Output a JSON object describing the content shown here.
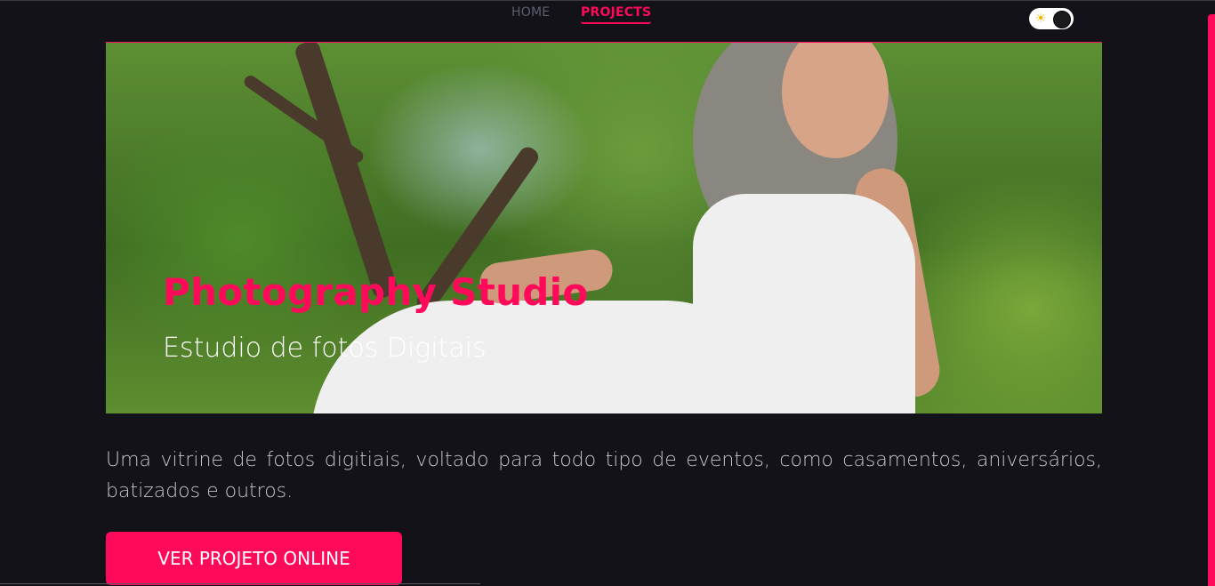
{
  "nav": {
    "home_label": "HOME",
    "projects_label": "PROJECTS"
  },
  "theme_toggle": {
    "state": "dark",
    "sun_icon": "sun-icon"
  },
  "hero": {
    "title": "Photography Studio",
    "subtitle": "Estudio de fotos Digitais"
  },
  "description": "Uma vitrine de fotos digitiais, voltado para todo tipo de eventos, como casamentos, aniversários, batizados e outros.",
  "cta": {
    "label": "VER PROJETO ONLINE"
  },
  "colors": {
    "background": "#131218",
    "accent": "#ff0a5a",
    "text_muted": "#c4c4cb",
    "nav_inactive": "#5c5f6e"
  }
}
